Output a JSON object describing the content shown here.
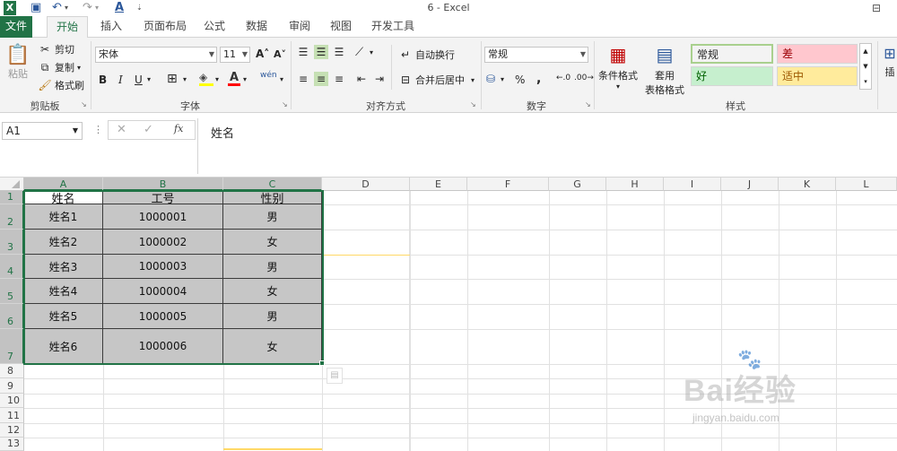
{
  "titlebar": {
    "title": "6 - Excel"
  },
  "tabs": [
    "文件",
    "开始",
    "插入",
    "页面布局",
    "公式",
    "数据",
    "审阅",
    "视图",
    "开发工具"
  ],
  "clipboard": {
    "paste": "粘贴",
    "cut": "剪切",
    "copy": "复制",
    "format_painter": "格式刷",
    "label": "剪贴板"
  },
  "font": {
    "name": "宋体",
    "size": "11",
    "bold": "B",
    "italic": "I",
    "underline": "U",
    "wen": "wén",
    "label": "字体"
  },
  "alignment": {
    "wrap": "自动换行",
    "merge": "合并后居中",
    "label": "对齐方式"
  },
  "number": {
    "format": "常规",
    "percent": "%",
    "comma": ",",
    "label": "数字"
  },
  "styles": {
    "conditional": "条件格式",
    "table_format_1": "套用",
    "table_format_2": "表格格式",
    "cells": [
      {
        "text": "常规",
        "bg": "#ffffff",
        "color": "#262626"
      },
      {
        "text": "差",
        "bg": "#ffc7ce",
        "color": "#9c0006"
      },
      {
        "text": "好",
        "bg": "#c6efce",
        "color": "#006100"
      },
      {
        "text": "适中",
        "bg": "#ffeb9c",
        "color": "#9c5700"
      }
    ],
    "label": "样式"
  },
  "insert": {
    "label": "插"
  },
  "formula_bar": {
    "namebox": "A1",
    "fx": "fx",
    "content": "姓名"
  },
  "columns": [
    "A",
    "B",
    "C",
    "D",
    "E",
    "F",
    "G",
    "H",
    "I",
    "J",
    "K",
    "L"
  ],
  "rows": [
    "1",
    "2",
    "3",
    "4",
    "5",
    "6",
    "7",
    "8",
    "9",
    "10",
    "11",
    "12",
    "13"
  ],
  "table": {
    "headers": [
      "姓名",
      "工号",
      "性别"
    ],
    "rows": [
      [
        "姓名1",
        "1000001",
        "男"
      ],
      [
        "姓名2",
        "1000002",
        "女"
      ],
      [
        "姓名3",
        "1000003",
        "男"
      ],
      [
        "姓名4",
        "1000004",
        "女"
      ],
      [
        "姓名5",
        "1000005",
        "男"
      ],
      [
        "姓名6",
        "1000006",
        "女"
      ]
    ]
  },
  "watermark": {
    "brand": "Bai经验",
    "url": "jingyan.baidu.com"
  },
  "colors": {
    "accent": "#217346"
  }
}
